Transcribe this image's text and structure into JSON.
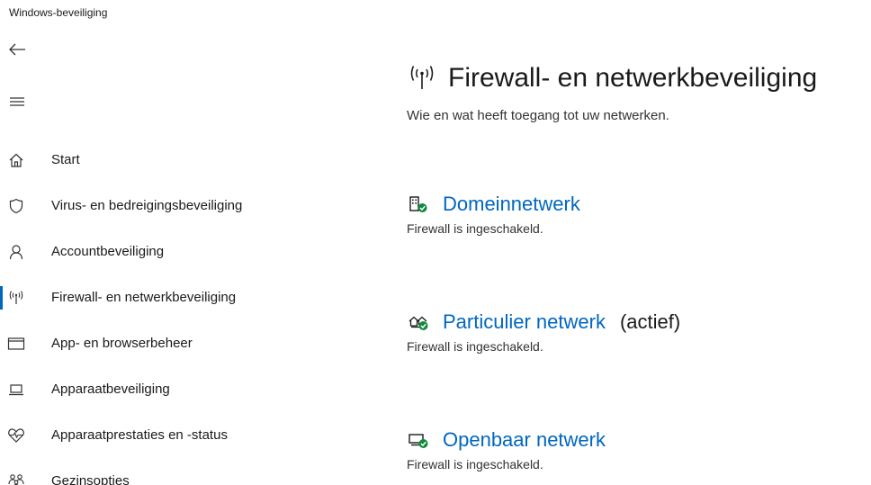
{
  "window": {
    "title": "Windows-beveiliging"
  },
  "navigation": {
    "back_icon": "arrow-left-icon",
    "menu_icon": "hamburger-icon",
    "items": [
      {
        "label": "Start",
        "icon": "home-icon",
        "selected": false
      },
      {
        "label": "Virus- en bedreigingsbeveiliging",
        "icon": "shield-icon",
        "selected": false
      },
      {
        "label": "Accountbeveiliging",
        "icon": "person-icon",
        "selected": false
      },
      {
        "label": "Firewall- en netwerkbeveiliging",
        "icon": "wireless-antenna-icon",
        "selected": true
      },
      {
        "label": "App- en browserbeheer",
        "icon": "app-window-icon",
        "selected": false
      },
      {
        "label": "Apparaatbeveiliging",
        "icon": "laptop-icon",
        "selected": false
      },
      {
        "label": "Apparaatprestaties en -status",
        "icon": "heart-pulse-icon",
        "selected": false
      },
      {
        "label": "Gezinsopties",
        "icon": "family-icon",
        "selected": false
      }
    ]
  },
  "main": {
    "title": "Firewall- en netwerkbeveiliging",
    "title_icon": "wireless-antenna-icon",
    "subtitle": "Wie en wat heeft toegang tot uw netwerken.",
    "networks": [
      {
        "name": "Domeinnetwerk",
        "active_label": "",
        "status": "Firewall is ingeschakeld.",
        "icon": "domain-network-icon"
      },
      {
        "name": "Particulier netwerk",
        "active_label": "(actief)",
        "status": "Firewall is ingeschakeld.",
        "icon": "private-network-icon"
      },
      {
        "name": "Openbaar netwerk",
        "active_label": "",
        "status": "Firewall is ingeschakeld.",
        "icon": "public-network-icon"
      }
    ]
  },
  "colors": {
    "accent": "#0067c0",
    "check_green": "#10893e",
    "text": "#1a1a1a"
  }
}
